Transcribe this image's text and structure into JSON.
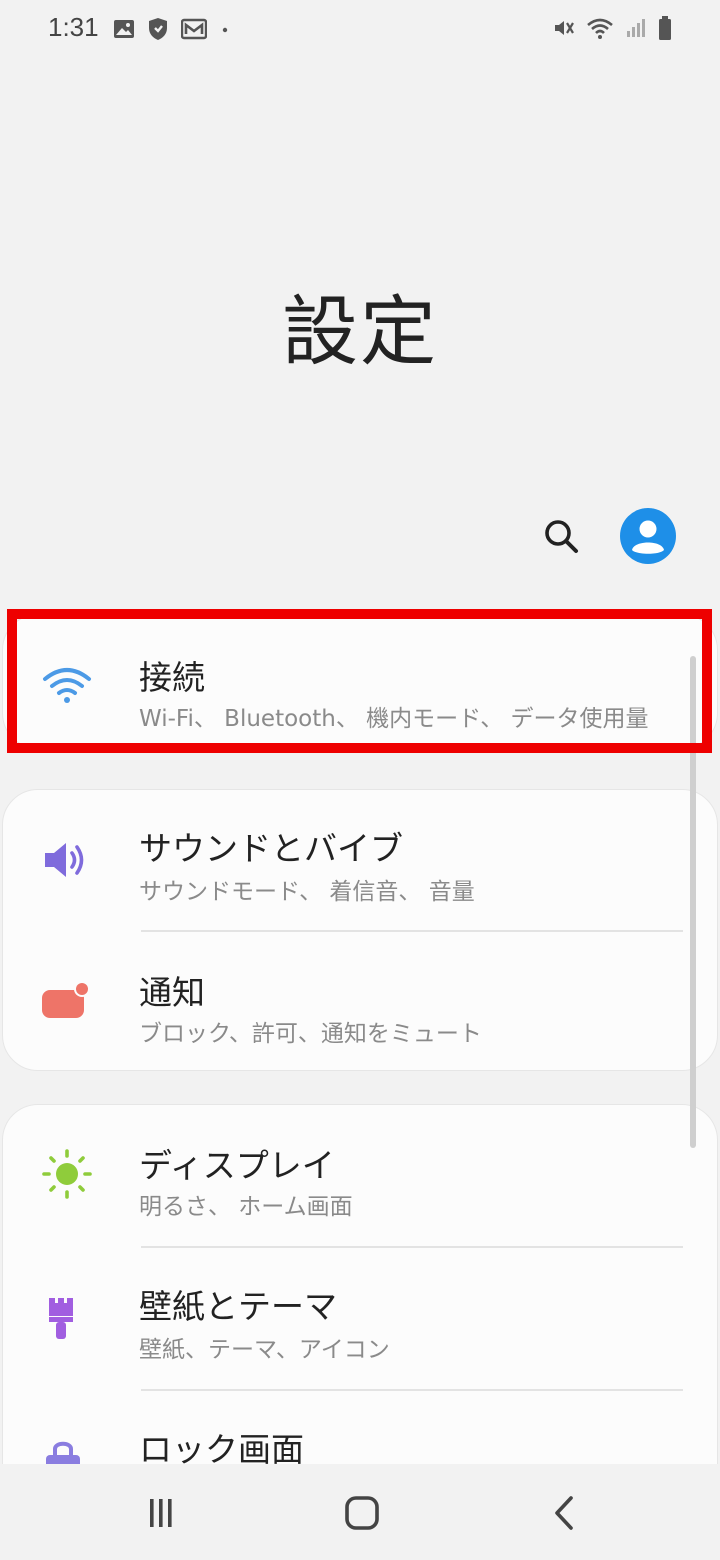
{
  "status_bar": {
    "time": "1:31",
    "left_icons": [
      "gallery-icon",
      "shield-icon",
      "mail-icon",
      "dot-icon"
    ],
    "right_icons": [
      "mute-vibrate-icon",
      "wifi-icon",
      "signal-icon",
      "battery-icon"
    ]
  },
  "header": {
    "title": "設定"
  },
  "actions": {
    "search_icon": "search-icon",
    "account_icon": "account-icon"
  },
  "settings": {
    "connections": {
      "title": "接続",
      "subtitle": "Wi-Fi、 Bluetooth、 機内モード、 データ使用量",
      "icon": "wifi-icon",
      "color": "#4c9ae6"
    },
    "sound": {
      "title": "サウンドとバイブ",
      "subtitle": "サウンドモード、 着信音、 音量",
      "icon": "speaker-icon",
      "color": "#7f6bdc"
    },
    "notifications": {
      "title": "通知",
      "subtitle": "ブロック、許可、通知をミュート",
      "icon": "notification-icon",
      "color": "#ee7468"
    },
    "display": {
      "title": "ディスプレイ",
      "subtitle": "明るさ、 ホーム画面",
      "icon": "sun-icon",
      "color": "#8fcc3b"
    },
    "wallpaper": {
      "title": "壁紙とテーマ",
      "subtitle": "壁紙、テーマ、アイコン",
      "icon": "brush-icon",
      "color": "#a15ee0"
    },
    "lockscreen": {
      "title": "ロック画面",
      "icon": "lock-icon",
      "color": "#8a7de0"
    }
  },
  "navigation": {
    "recents_icon": "recents-icon",
    "home_icon": "home-icon",
    "back_icon": "back-icon"
  },
  "highlight_color": "#ee0000"
}
